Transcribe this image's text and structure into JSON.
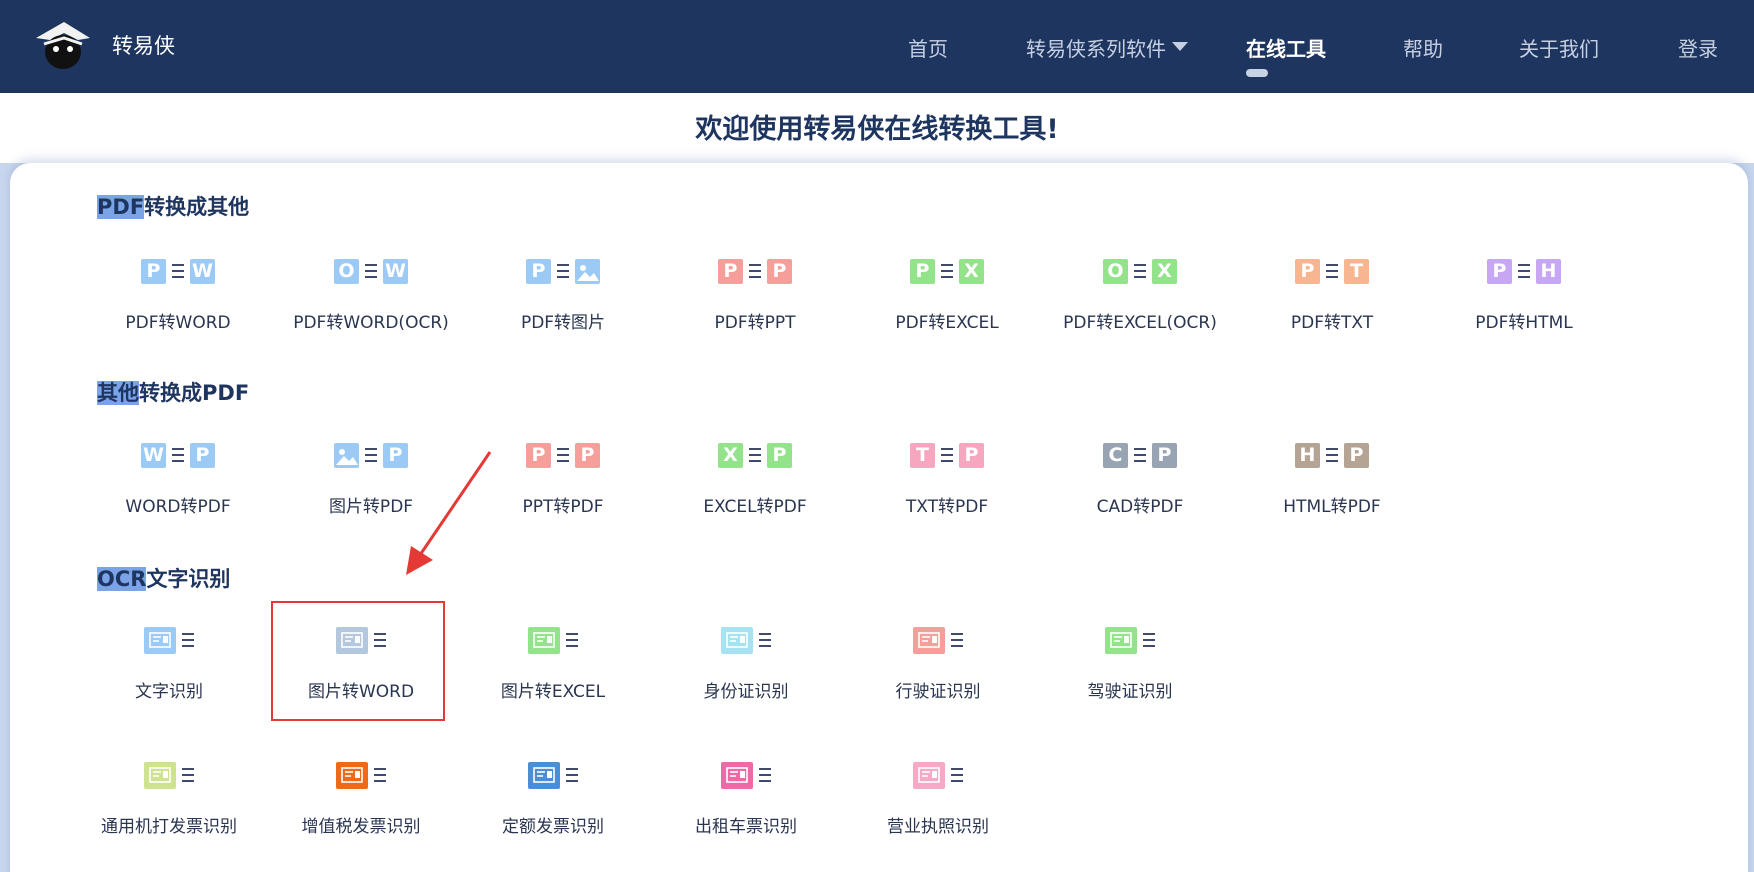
{
  "header": {
    "brand": "转易侠",
    "nav": [
      {
        "label": "首页"
      },
      {
        "label": "转易侠系列软件"
      },
      {
        "label": "在线工具"
      },
      {
        "label": "帮助"
      },
      {
        "label": "关于我们"
      },
      {
        "label": "登录"
      }
    ]
  },
  "welcome": "欢迎使用转易侠在线转换工具!",
  "sections": [
    {
      "title_hl": "PDF",
      "title_rest": "转换成其他",
      "tools": [
        {
          "label": "PDF转WORD",
          "left": {
            "letter": "P",
            "color": "#9ccaf6"
          },
          "right": {
            "letter": "W",
            "color": "#9ccaf6"
          }
        },
        {
          "label": "PDF转WORD(OCR)",
          "left": {
            "letter": "O",
            "color": "#9ccaf6"
          },
          "right": {
            "letter": "W",
            "color": "#9ccaf6"
          }
        },
        {
          "label": "PDF转图片",
          "left": {
            "letter": "P",
            "color": "#9ccaf6"
          },
          "right": {
            "letter": "image",
            "color": "#9ccaf6"
          }
        },
        {
          "label": "PDF转PPT",
          "left": {
            "letter": "P",
            "color": "#f59e9a"
          },
          "right": {
            "letter": "P",
            "color": "#f59e9a"
          }
        },
        {
          "label": "PDF转EXCEL",
          "left": {
            "letter": "P",
            "color": "#93e38b"
          },
          "right": {
            "letter": "X",
            "color": "#93e38b"
          }
        },
        {
          "label": "PDF转EXCEL(OCR)",
          "left": {
            "letter": "O",
            "color": "#93e38b"
          },
          "right": {
            "letter": "X",
            "color": "#93e38b"
          }
        },
        {
          "label": "PDF转TXT",
          "left": {
            "letter": "P",
            "color": "#f7b68f"
          },
          "right": {
            "letter": "T",
            "color": "#f7b68f"
          }
        },
        {
          "label": "PDF转HTML",
          "left": {
            "letter": "P",
            "color": "#c7a6f3"
          },
          "right": {
            "letter": "H",
            "color": "#c7a6f3"
          }
        }
      ]
    },
    {
      "title_hl": "其他",
      "title_rest": "转换成PDF",
      "tools": [
        {
          "label": "WORD转PDF",
          "left": {
            "letter": "W",
            "color": "#9ccaf6"
          },
          "right": {
            "letter": "P",
            "color": "#9ccaf6"
          }
        },
        {
          "label": "图片转PDF",
          "left": {
            "letter": "image",
            "color": "#9ccaf6"
          },
          "right": {
            "letter": "P",
            "color": "#9ccaf6"
          }
        },
        {
          "label": "PPT转PDF",
          "left": {
            "letter": "P",
            "color": "#f59e9a"
          },
          "right": {
            "letter": "P",
            "color": "#f59e9a"
          }
        },
        {
          "label": "EXCEL转PDF",
          "left": {
            "letter": "X",
            "color": "#93e38b"
          },
          "right": {
            "letter": "P",
            "color": "#93e38b"
          }
        },
        {
          "label": "TXT转PDF",
          "left": {
            "letter": "T",
            "color": "#f7a6bf"
          },
          "right": {
            "letter": "P",
            "color": "#f7a6bf"
          }
        },
        {
          "label": "CAD转PDF",
          "left": {
            "letter": "C",
            "color": "#98a4b4"
          },
          "right": {
            "letter": "P",
            "color": "#98a4b4"
          }
        },
        {
          "label": "HTML转PDF",
          "left": {
            "letter": "H",
            "color": "#b5a394"
          },
          "right": {
            "letter": "P",
            "color": "#b5a394"
          }
        }
      ]
    },
    {
      "title_hl": "OCR",
      "title_rest": "文字识别",
      "tools": [
        {
          "label": "文字识别",
          "icon": "text-recognition-icon",
          "color": "#9ccaf6"
        },
        {
          "label": "图片转WORD",
          "icon": "image-to-word-icon",
          "color": "#b3c7df"
        },
        {
          "label": "图片转EXCEL",
          "icon": "image-to-excel-icon",
          "color": "#93e38b"
        },
        {
          "label": "身份证识别",
          "icon": "id-card-icon",
          "color": "#a6e3f2"
        },
        {
          "label": "行驶证识别",
          "icon": "driving-license-icon",
          "color": "#f59e9a"
        },
        {
          "label": "驾驶证识别",
          "icon": "driver-license-icon",
          "color": "#93e38b"
        },
        {
          "label": "通用机打发票识别",
          "icon": "machine-invoice-icon",
          "color": "#cfe28f"
        },
        {
          "label": "增值税发票识别",
          "icon": "vat-invoice-icon",
          "color": "#ee6a18"
        },
        {
          "label": "定额发票识别",
          "icon": "quota-invoice-icon",
          "color": "#4a8fd6"
        },
        {
          "label": "出租车票识别",
          "icon": "taxi-ticket-icon",
          "color": "#ee6aa6"
        },
        {
          "label": "营业执照识别",
          "icon": "business-license-icon",
          "color": "#f6a9c6"
        }
      ]
    }
  ],
  "annotation_color": "#e53935"
}
